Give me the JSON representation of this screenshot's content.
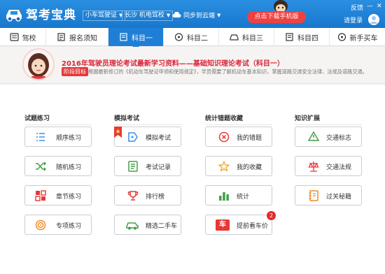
{
  "app": {
    "title": "驾考宝典"
  },
  "topbar": {
    "license_select": "小车驾驶证",
    "city_select": "长沙 机电驾校",
    "sync_label": "同步到云端",
    "download_btn": "点击下载手机版",
    "feedback": "反馈",
    "login": "请登录"
  },
  "nav": {
    "items": [
      {
        "label": "驾校"
      },
      {
        "label": "报名须知"
      },
      {
        "label": "科目一"
      },
      {
        "label": "科目二"
      },
      {
        "label": "科目三"
      },
      {
        "label": "科目四"
      },
      {
        "label": "新手买车"
      }
    ],
    "active_index": 2
  },
  "banner": {
    "title": "2016年驾驶员理论考试最新学习资料——基础知识理论考试（科目一）",
    "tag": "阶段目标",
    "desc": "根据最新修订的《机动车驾驶证申领和使用规定》，学员需要了解机动车基本知识，掌握道路交通安全法律、法规及道路交通。"
  },
  "columns": [
    {
      "heading": "试题练习",
      "items": [
        {
          "label": "顺序练习",
          "icon": "list-icon"
        },
        {
          "label": "随机练习",
          "icon": "shuffle-icon"
        },
        {
          "label": "章节练习",
          "icon": "chapter-icon"
        },
        {
          "label": "专项练习",
          "icon": "target-icon"
        }
      ]
    },
    {
      "heading": "模拟考试",
      "items": [
        {
          "label": "模拟考试",
          "icon": "exam-icon"
        },
        {
          "label": "考试记录",
          "icon": "record-icon"
        },
        {
          "label": "排行榜",
          "icon": "trophy-icon"
        },
        {
          "label": "精选二手车",
          "icon": "car-icon"
        }
      ]
    },
    {
      "heading": "统计错题收藏",
      "items": [
        {
          "label": "我的错题",
          "icon": "wrong-icon"
        },
        {
          "label": "我的收藏",
          "icon": "star-icon"
        },
        {
          "label": "统计",
          "icon": "stats-icon"
        },
        {
          "label": "提前看车价",
          "icon": "price-icon",
          "badge": "2",
          "icon_text": "车"
        }
      ]
    },
    {
      "heading": "知识扩展",
      "items": [
        {
          "label": "交通标志",
          "icon": "sign-icon"
        },
        {
          "label": "交通法规",
          "icon": "law-icon"
        },
        {
          "label": "过关秘籍",
          "icon": "book-icon"
        }
      ]
    }
  ],
  "colors": {
    "brand_blue": "#1f7fd6",
    "alert_red": "#e6383a",
    "icon_blue": "#3a8ee6",
    "icon_green": "#43a047",
    "icon_orange": "#f08a24",
    "icon_red": "#e53935"
  }
}
